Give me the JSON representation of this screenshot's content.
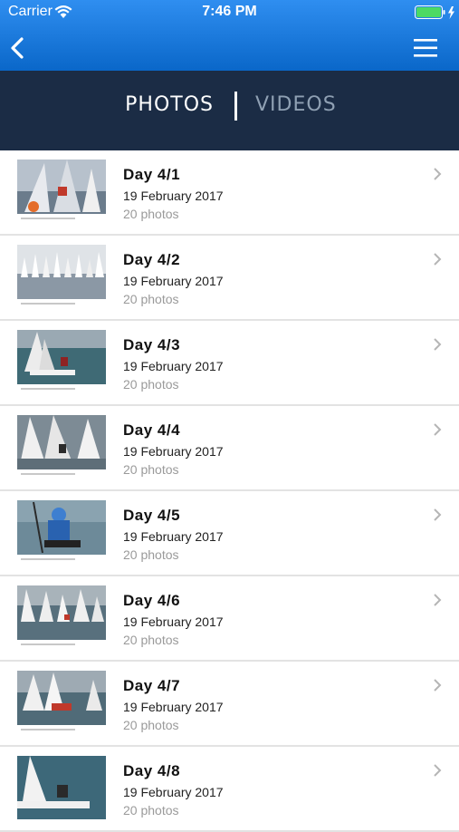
{
  "status_bar": {
    "carrier": "Carrier",
    "time": "7:46 PM",
    "battery_color": "#4cd964"
  },
  "nav": {
    "back_icon": "chevron-left-icon",
    "menu_icon": "hamburger-menu-icon"
  },
  "tabs": {
    "photos_label": "PHOTOS",
    "videos_label": "VIDEOS",
    "active": "photos"
  },
  "albums": [
    {
      "title": "Day 4/1",
      "date": "19 February 2017",
      "count": "20 photos"
    },
    {
      "title": "Day 4/2",
      "date": "19 February 2017",
      "count": "20 photos"
    },
    {
      "title": "Day 4/3",
      "date": "19 February 2017",
      "count": "20 photos"
    },
    {
      "title": "Day 4/4",
      "date": "19 February 2017",
      "count": "20 photos"
    },
    {
      "title": "Day 4/5",
      "date": "19 February 2017",
      "count": "20 photos"
    },
    {
      "title": "Day 4/6",
      "date": "19 February 2017",
      "count": "20 photos"
    },
    {
      "title": "Day 4/7",
      "date": "19 February 2017",
      "count": "20 photos"
    },
    {
      "title": "Day 4/8",
      "date": "19 February 2017",
      "count": "20 photos"
    }
  ],
  "colors": {
    "header_top": "#2f8ef0",
    "header_bottom": "#0a67c9",
    "tabs_background": "#1b2c45",
    "active_tab": "#ffffff",
    "inactive_tab": "#8fa0b3"
  }
}
